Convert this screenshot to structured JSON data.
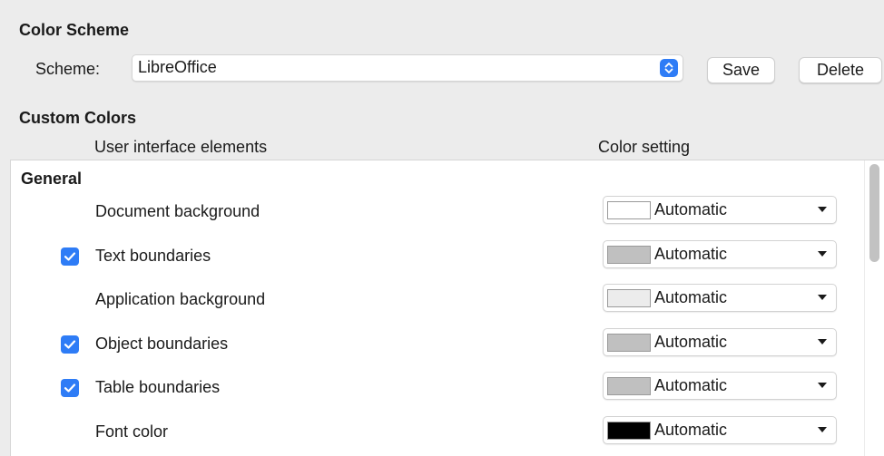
{
  "color_scheme": {
    "title": "Color Scheme",
    "scheme_label": "Scheme:",
    "scheme_value": "LibreOffice",
    "save_label": "Save",
    "delete_label": "Delete"
  },
  "custom_colors": {
    "title": "Custom Colors",
    "column_elements": "User interface elements",
    "column_setting": "Color setting",
    "groups": [
      {
        "title": "General",
        "items": [
          {
            "label": "Document background",
            "has_checkbox": false,
            "checked": false,
            "value": "Automatic",
            "swatch": "#ffffff"
          },
          {
            "label": "Text boundaries",
            "has_checkbox": true,
            "checked": true,
            "value": "Automatic",
            "swatch": "#c0c0c0"
          },
          {
            "label": "Application background",
            "has_checkbox": false,
            "checked": false,
            "value": "Automatic",
            "swatch": "#ececec"
          },
          {
            "label": "Object boundaries",
            "has_checkbox": true,
            "checked": true,
            "value": "Automatic",
            "swatch": "#c0c0c0"
          },
          {
            "label": "Table boundaries",
            "has_checkbox": true,
            "checked": true,
            "value": "Automatic",
            "swatch": "#c0c0c0"
          },
          {
            "label": "Font color",
            "has_checkbox": false,
            "checked": false,
            "value": "Automatic",
            "swatch": "#000000"
          }
        ]
      }
    ]
  },
  "colors": {
    "accent": "#2e7cf6",
    "panel_background": "#ffffff",
    "window_background": "#ececec"
  },
  "icons": {
    "scheme_stepper": "chevron-up-down-icon",
    "checkbox": "checkmark-icon",
    "dropdown": "caret-down-icon"
  }
}
